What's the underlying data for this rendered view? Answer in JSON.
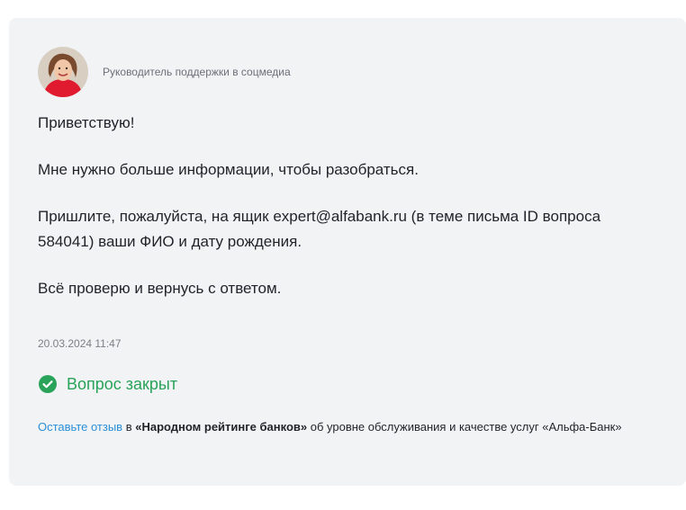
{
  "author": {
    "role": "Руководитель поддержки в соцмедиа"
  },
  "message": {
    "paragraphs": [
      "Приветствую!",
      "Мне нужно больше информации, чтобы разобраться.",
      "Пришлите, пожалуйста, на ящик expert@alfabank.ru (в теме письма ID вопроса 584041) ваши ФИО и дату рождения.",
      "Всё проверю и вернусь с ответом."
    ]
  },
  "timestamp": "20.03.2024 11:47",
  "status": {
    "icon": "check-circle-icon",
    "label": "Вопрос закрыт",
    "color": "#2aa35a"
  },
  "feedback": {
    "link_text": "Оставьте отзыв",
    "text_in": " в ",
    "rating_name": "«Народном рейтинге банков»",
    "text_rest": " об уровне обслуживания и качестве услуг «Альфа-Банк»",
    "link_color": "#2b8fd8"
  }
}
